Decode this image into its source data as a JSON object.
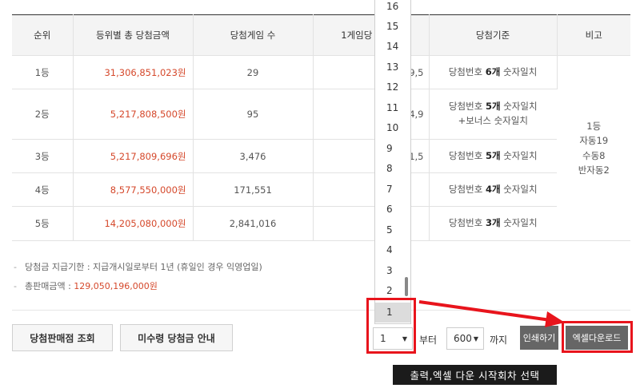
{
  "table": {
    "headers": [
      "순위",
      "등위별 총 당첨금액",
      "당첨게임 수",
      "1게임당 당첨금",
      "당첨기준",
      "비고"
    ],
    "rows": [
      {
        "rank": "1등",
        "prize": "31,306,851,023원",
        "count": "29",
        "per": "1,079,5",
        "crit_a": "당첨번호 ",
        "crit_b": "6개",
        "crit_c": " 숫자일치",
        "crit_d": ""
      },
      {
        "rank": "2등",
        "prize": "5,217,808,500원",
        "count": "95",
        "per": "54,9",
        "crit_a": "당첨번호 ",
        "crit_b": "5개",
        "crit_c": " 숫자일치",
        "crit_d": "+보너스 숫자일치"
      },
      {
        "rank": "3등",
        "prize": "5,217,809,696원",
        "count": "3,476",
        "per": "1,5",
        "crit_a": "당첨번호 ",
        "crit_b": "5개",
        "crit_c": " 숫자일치",
        "crit_d": ""
      },
      {
        "rank": "4등",
        "prize": "8,577,550,000원",
        "count": "171,551",
        "per": "",
        "crit_a": "당첨번호 ",
        "crit_b": "4개",
        "crit_c": " 숫자일치",
        "crit_d": ""
      },
      {
        "rank": "5등",
        "prize": "14,205,080,000원",
        "count": "2,841,016",
        "per": "",
        "crit_a": "당첨번호 ",
        "crit_b": "3개",
        "crit_c": " 숫자일치",
        "crit_d": ""
      }
    ],
    "note_lines": [
      "1등",
      "자동19",
      "수동8",
      "반자동2"
    ]
  },
  "notes": {
    "deadline_label": "당첨금 지급기한 : 지급개시일로부터 1년 (휴일인 경우 익영업일)",
    "sales_label": "총판매금액 : ",
    "sales_value": "129,050,196,000원"
  },
  "buttons": {
    "stores": "당첨판매점 조회",
    "unclaimed": "미수령 당첨금 안내",
    "print": "인쇄하기",
    "excel": "엑셀다운로드"
  },
  "range": {
    "from_value": "1",
    "from_label": "부터",
    "to_value": "600",
    "to_label": "까지"
  },
  "dropdown": {
    "options": [
      "16",
      "15",
      "14",
      "13",
      "12",
      "11",
      "10",
      "9",
      "8",
      "7",
      "6",
      "5",
      "4",
      "3",
      "2",
      "1"
    ],
    "selected": "1"
  },
  "annotation": {
    "tooltip": "출력,엑셀 다운 시작회차 선택",
    "highlight_color": "#e8141c"
  }
}
